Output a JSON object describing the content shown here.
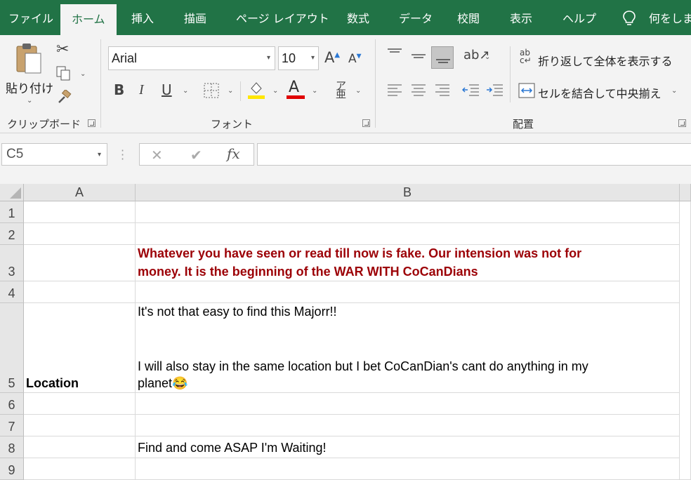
{
  "tabs": [
    "ファイル",
    "ホーム",
    "挿入",
    "描画",
    "ページ レイアウト",
    "数式",
    "データ",
    "校閲",
    "表示",
    "ヘルプ",
    "何をしま"
  ],
  "ribbon": {
    "paste_label": "貼り付け",
    "clipboard_label": "クリップボード",
    "font_label": "フォント",
    "alignment_label": "配置",
    "font_name": "Arial",
    "font_size": "10",
    "bold": "B",
    "italic": "I",
    "underline": "U",
    "wrap_text": "折り返して全体を表示する",
    "merge_center": "セルを結合して中央揃え",
    "font_color_accent": "#c00000",
    "fill_color_accent": "#ffe600"
  },
  "formula_bar": {
    "name_box": "C5",
    "cancel": "✕",
    "enter": "✔",
    "fx": "fx",
    "formula": ""
  },
  "columns": [
    "A",
    "B"
  ],
  "rows": [
    "1",
    "2",
    "3",
    "4",
    "5",
    "6",
    "7",
    "8",
    "9"
  ],
  "cells": {
    "b3_line1": "Whatever you have seen or read till now is fake. Our intension was not for",
    "b3_line2": "money. It is the beginning of the WAR WITH CoCanDians",
    "a5": "Location",
    "b5_line1": "It's not that easy to find this Majorr!!",
    "b5_line2": "I will also stay in the same location but I bet CoCanDian's cant do anything in my",
    "b5_line3": "planet😂",
    "b8": "Find and come ASAP I'm Waiting!"
  },
  "colors": {
    "excel_green": "#217346",
    "warning_red": "#9c0006"
  }
}
